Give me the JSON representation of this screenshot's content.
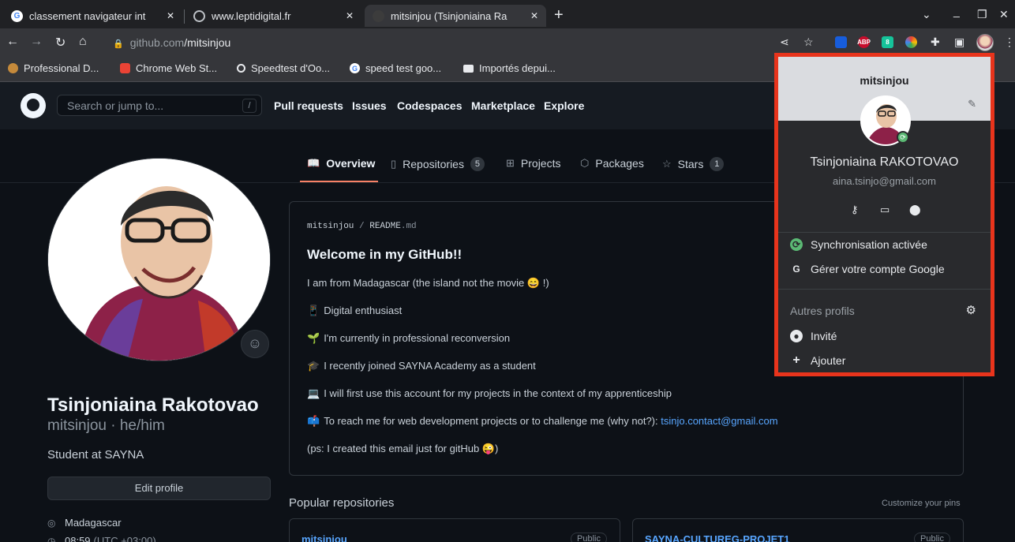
{
  "browser": {
    "tabs": [
      {
        "title": "classement navigateur int",
        "favicon": "google-icon"
      },
      {
        "title": "www.leptidigital.fr",
        "favicon": "globe-icon"
      },
      {
        "title": "mitsinjou (Tsinjoniaina Ra",
        "favicon": "github-icon",
        "active": true
      }
    ],
    "url_host": "github.com",
    "url_path": "/mitsinjou",
    "bookmarks": [
      {
        "label": "Professional D...",
        "icon": "bookmark-icon"
      },
      {
        "label": "Chrome Web St...",
        "icon": "chrome-web-store-icon"
      },
      {
        "label": "Speedtest d'Oo...",
        "icon": "speedtest-icon"
      },
      {
        "label": "speed test goo...",
        "icon": "google-icon"
      },
      {
        "label": "Importés depui...",
        "icon": "folder-icon"
      }
    ],
    "extensions": [
      {
        "name": "bitwarden-icon",
        "color": "#175ddc",
        "text": ""
      },
      {
        "name": "adblock-plus-icon",
        "color": "#c70d2c",
        "text": "ABP"
      },
      {
        "name": "grammarly-icon",
        "color": "#15c39a",
        "text": "8"
      },
      {
        "name": "color-picker-icon",
        "color": "#4285f4",
        "text": ""
      }
    ]
  },
  "github": {
    "search_placeholder": "Search or jump to...",
    "search_key": "/",
    "nav": [
      "Pull requests",
      "Issues",
      "Codespaces",
      "Marketplace",
      "Explore"
    ]
  },
  "profile_tabs": [
    {
      "label": "Overview",
      "icon": "book-icon"
    },
    {
      "label": "Repositories",
      "icon": "repo-icon",
      "count": "5"
    },
    {
      "label": "Projects",
      "icon": "table-icon"
    },
    {
      "label": "Packages",
      "icon": "package-icon"
    },
    {
      "label": "Stars",
      "icon": "star-icon",
      "count": "1"
    }
  ],
  "profile": {
    "name": "Tsinjoniaina Rakotovao",
    "login": "mitsinjou · he/him",
    "bio": "Student at SAYNA",
    "edit_label": "Edit profile",
    "location": "Madagascar",
    "time": "08:59",
    "timezone": "(UTC +03:00)"
  },
  "readme": {
    "owner": "mitsinjou",
    "file": "README",
    "ext": ".md",
    "title": "Welcome in my GitHub!!",
    "lines": [
      {
        "emoji": "",
        "text": "I am from Madagascar (the island not the movie 😄 !)"
      },
      {
        "emoji": "📱",
        "text": "Digital enthusiast"
      },
      {
        "emoji": "🌱",
        "text": "I'm currently in professional reconversion"
      },
      {
        "emoji": "🎓",
        "text": "I recently joined SAYNA Academy as a student"
      },
      {
        "emoji": "💻",
        "text": "I will first use this account for my projects in the context of my apprenticeship"
      },
      {
        "emoji": "📫",
        "text": "To reach me for web development projects or to challenge me (why not?): ",
        "link": "tsinjo.contact@gmail.com"
      },
      {
        "emoji": "",
        "text": "(ps: I created this email just for gitHub 😜)"
      }
    ]
  },
  "popular": {
    "title": "Popular repositories",
    "customize": "Customize your pins",
    "repos": [
      {
        "name": "mitsinjou",
        "visibility": "Public"
      },
      {
        "name": "SAYNA-CULTUREG-PROJET1",
        "visibility": "Public"
      }
    ]
  },
  "profile_popup": {
    "header": "mitsinjou",
    "full_name": "Tsinjoniaina RAKOTOVAO",
    "email": "aina.tsinjo@gmail.com",
    "sync_label": "Synchronisation activée",
    "manage_label": "Gérer votre compte Google",
    "other_profiles": "Autres profils",
    "guest_label": "Invité",
    "add_label": "Ajouter",
    "highlight_color": "#e8341c"
  }
}
